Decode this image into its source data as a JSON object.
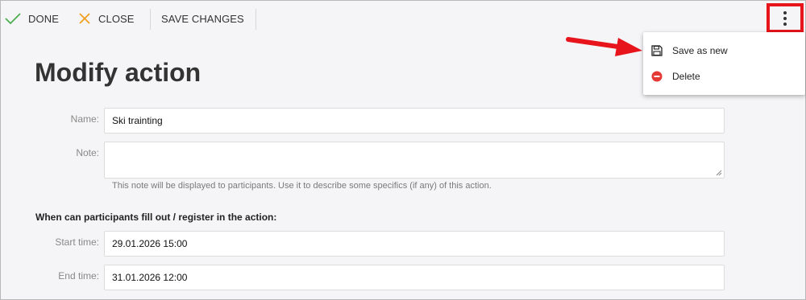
{
  "toolbar": {
    "done_label": "DONE",
    "close_label": "CLOSE",
    "save_changes_label": "SAVE CHANGES",
    "done_icon": "check-icon",
    "close_icon": "x-icon",
    "more_icon": "kebab-menu-icon",
    "done_color": "#4caf50",
    "close_color": "#f0a020"
  },
  "page": {
    "title": "Modify action"
  },
  "form": {
    "name": {
      "label": "Name:",
      "value": "Ski trainting"
    },
    "note": {
      "label": "Note:",
      "value": "",
      "help": "This note will be displayed to participants. Use it to describe some specifics (if any) of this action."
    },
    "section_heading": "When can participants fill out / register in the action:",
    "start_time": {
      "label": "Start time:",
      "value": "29.01.2026 15:00"
    },
    "end_time": {
      "label": "End time:",
      "value": "31.01.2026 12:00"
    }
  },
  "menu": {
    "items": [
      {
        "label": "Save as new",
        "icon": "floppy-disk-icon"
      },
      {
        "label": "Delete",
        "icon": "minus-circle-icon",
        "color": "#e53935"
      }
    ]
  },
  "annotation": {
    "highlight_color": "#e8141b",
    "arrow_color": "#e8141b"
  }
}
